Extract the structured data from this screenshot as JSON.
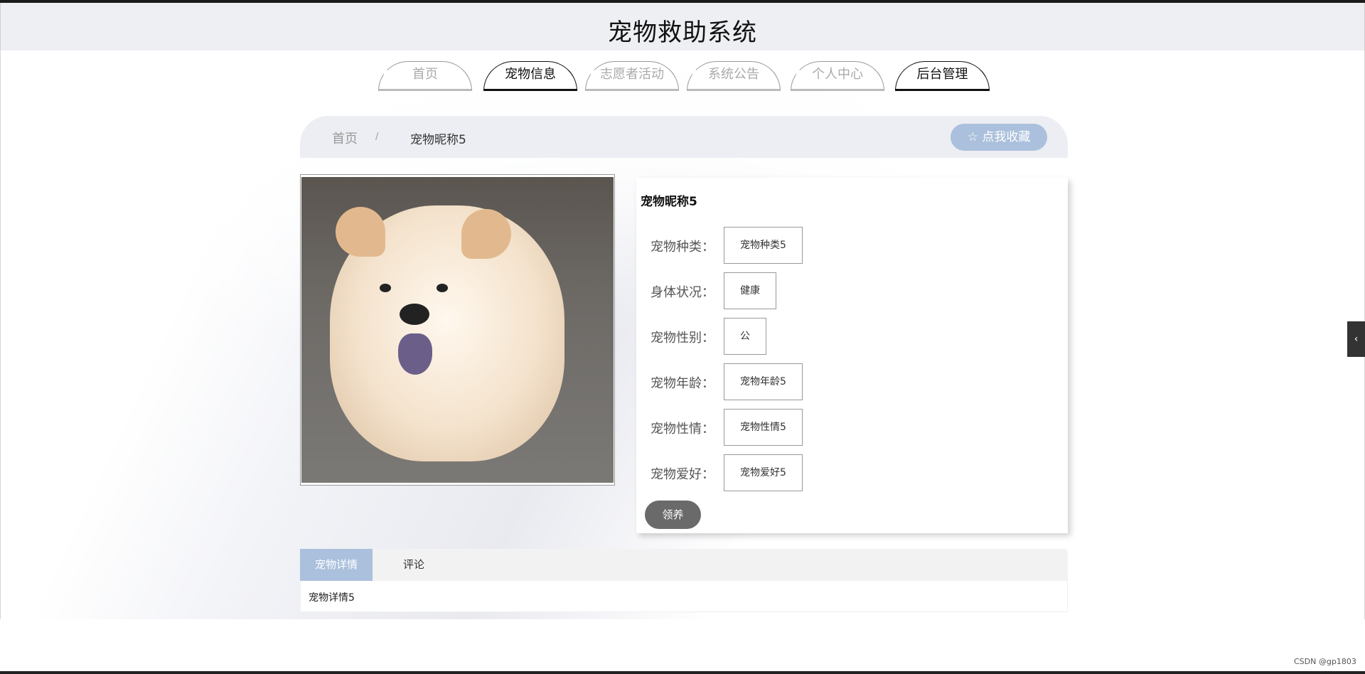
{
  "site": {
    "title": "宠物救助系统"
  },
  "nav": {
    "items": [
      {
        "label": "首页",
        "active": false
      },
      {
        "label": "宠物信息",
        "active": true
      },
      {
        "label": "志愿者活动",
        "active": false
      },
      {
        "label": "系统公告",
        "active": false
      },
      {
        "label": "个人中心",
        "active": false
      },
      {
        "label": "后台管理",
        "active": true
      }
    ]
  },
  "breadcrumb": {
    "home": "首页",
    "separator": "/",
    "current": "宠物昵称5"
  },
  "favorite": {
    "label": "☆ 点我收藏"
  },
  "pet": {
    "name": "宠物昵称5",
    "fields": [
      {
        "label": "宠物种类：",
        "value": "宠物种类5"
      },
      {
        "label": "身体状况：",
        "value": "健康"
      },
      {
        "label": "宠物性别：",
        "value": "公"
      },
      {
        "label": "宠物年龄：",
        "value": "宠物年龄5"
      },
      {
        "label": "宠物性情：",
        "value": "宠物性情5"
      },
      {
        "label": "宠物爱好：",
        "value": "宠物爱好5"
      }
    ],
    "adopt_label": "领养"
  },
  "tabs": {
    "details": "宠物详情",
    "comments": "评论",
    "details_content": "宠物详情5"
  },
  "sidebar_toggle": {
    "icon": "chevron-left-icon",
    "glyph": "‹"
  },
  "watermark": "CSDN @gp1803",
  "colors": {
    "accent": "#abc0dc",
    "adopt": "#6a6a6a",
    "header_bg": "#eeeff3"
  }
}
